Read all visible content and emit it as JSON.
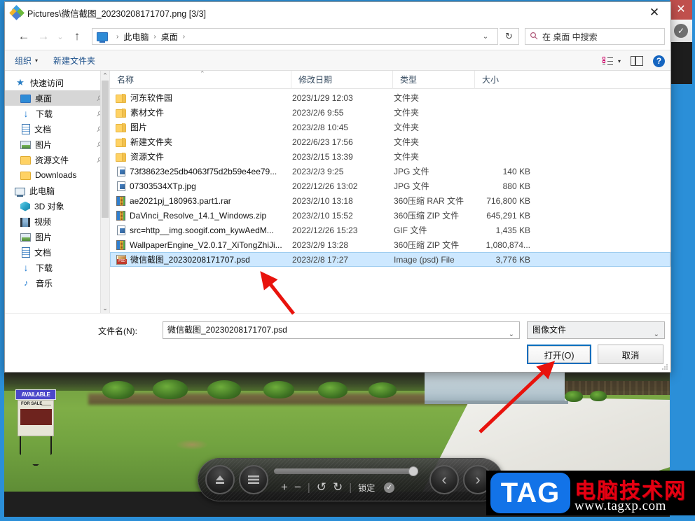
{
  "window": {
    "title": "Pictures\\微信截图_20230208171707.png [3/3]",
    "icon": "photo-viewer-icon",
    "close_label": "✕"
  },
  "nav": {
    "back": "←",
    "forward": "→",
    "recent": "⌄",
    "up": "↑",
    "breadcrumb": [
      "此电脑",
      "桌面"
    ],
    "breadcrumb_sep": "›",
    "refresh": "↻",
    "search_placeholder": "在 桌面 中搜索",
    "search_value": "",
    "search_icon": "search-icon"
  },
  "toolbar": {
    "organize": "组织",
    "organize_caret": "▾",
    "new_folder": "新建文件夹",
    "view_icon": "list-view-icon",
    "view_caret": "▾",
    "preview_pane_icon": "preview-pane-icon",
    "help": "?"
  },
  "sidebar": {
    "items": [
      {
        "label": "快速访问",
        "icon": "star-icon",
        "type": "root",
        "pinned": false,
        "selected": false
      },
      {
        "label": "桌面",
        "icon": "desktop-icon",
        "type": "child",
        "pinned": true,
        "selected": true
      },
      {
        "label": "下载",
        "icon": "download-icon",
        "type": "child",
        "pinned": true,
        "selected": false
      },
      {
        "label": "文档",
        "icon": "document-icon",
        "type": "child",
        "pinned": true,
        "selected": false
      },
      {
        "label": "图片",
        "icon": "picture-icon",
        "type": "child",
        "pinned": true,
        "selected": false
      },
      {
        "label": "资源文件",
        "icon": "folder-icon",
        "type": "child",
        "pinned": true,
        "selected": false
      },
      {
        "label": "Downloads",
        "icon": "folder-icon",
        "type": "child",
        "pinned": false,
        "selected": false
      },
      {
        "label": "此电脑",
        "icon": "pc-icon",
        "type": "root",
        "pinned": false,
        "selected": false
      },
      {
        "label": "3D 对象",
        "icon": "cube-icon",
        "type": "child",
        "pinned": false,
        "selected": false
      },
      {
        "label": "视频",
        "icon": "video-icon",
        "type": "child",
        "pinned": false,
        "selected": false
      },
      {
        "label": "图片",
        "icon": "picture-icon",
        "type": "child",
        "pinned": false,
        "selected": false
      },
      {
        "label": "文档",
        "icon": "document-icon",
        "type": "child",
        "pinned": false,
        "selected": false
      },
      {
        "label": "下载",
        "icon": "download-icon",
        "type": "child",
        "pinned": false,
        "selected": false
      },
      {
        "label": "音乐",
        "icon": "music-icon",
        "type": "child",
        "pinned": false,
        "selected": false
      }
    ],
    "scroll_up": "⌃",
    "scroll_down": "⌄"
  },
  "filelist": {
    "columns": [
      "名称",
      "修改日期",
      "类型",
      "大小"
    ],
    "sort_indicator": "⌃",
    "rows": [
      {
        "name": "河东软件园",
        "icon": "folder-icon",
        "date": "2023/1/29 12:03",
        "type": "文件夹",
        "size": "",
        "selected": false
      },
      {
        "name": "素材文件",
        "icon": "folder-icon",
        "date": "2023/2/6 9:55",
        "type": "文件夹",
        "size": "",
        "selected": false
      },
      {
        "name": "图片",
        "icon": "folder-icon",
        "date": "2023/2/8 10:45",
        "type": "文件夹",
        "size": "",
        "selected": false
      },
      {
        "name": "新建文件夹",
        "icon": "folder-icon",
        "date": "2022/6/23 17:56",
        "type": "文件夹",
        "size": "",
        "selected": false
      },
      {
        "name": "资源文件",
        "icon": "folder-icon",
        "date": "2023/2/15 13:39",
        "type": "文件夹",
        "size": "",
        "selected": false
      },
      {
        "name": "73f38623e25db4063f75d2b59e4ee79...",
        "icon": "jpg-icon",
        "date": "2023/2/3 9:25",
        "type": "JPG 文件",
        "size": "140 KB",
        "selected": false
      },
      {
        "name": "07303534XTp.jpg",
        "icon": "jpg-icon",
        "date": "2022/12/26 13:02",
        "type": "JPG 文件",
        "size": "880 KB",
        "selected": false
      },
      {
        "name": "ae2021pj_180963.part1.rar",
        "icon": "rar-icon",
        "date": "2023/2/10 13:18",
        "type": "360压缩 RAR 文件",
        "size": "716,800 KB",
        "selected": false
      },
      {
        "name": "DaVinci_Resolve_14.1_Windows.zip",
        "icon": "zip-icon",
        "date": "2023/2/10 15:52",
        "type": "360压缩 ZIP 文件",
        "size": "645,291 KB",
        "selected": false
      },
      {
        "name": "src=http__img.soogif.com_kywAedM...",
        "icon": "gif-icon",
        "date": "2022/12/26 15:23",
        "type": "GIF 文件",
        "size": "1,435 KB",
        "selected": false
      },
      {
        "name": "WallpaperEngine_V2.0.17_XiTongZhiJi...",
        "icon": "zip-icon",
        "date": "2023/2/9 13:28",
        "type": "360压缩 ZIP 文件",
        "size": "1,080,874...",
        "selected": false
      },
      {
        "name": "微信截图_20230208171707.psd",
        "icon": "psd-icon",
        "date": "2023/2/8 17:27",
        "type": "Image (psd) File",
        "size": "3,776 KB",
        "selected": true
      }
    ]
  },
  "form": {
    "filename_label": "文件名(N):",
    "filename_value": "微信截图_20230208171707.psd",
    "filetype_value": "图像文件",
    "dropdown_caret": "⌄",
    "open_button": "打开(O)",
    "cancel_button": "取消"
  },
  "background": {
    "close_label": "✕",
    "check_label": "✓",
    "media": {
      "eject_icon": "eject-icon",
      "menu_icon": "menu-icon",
      "zoom_in": "+",
      "zoom_out": "−",
      "rotate_left": "↺",
      "rotate_right": "↻",
      "lock_label": "锁定",
      "lock_check": "✓",
      "prev_icon": "‹",
      "next_icon": "›",
      "separator": "|"
    },
    "sign": {
      "top_text": "AVAILABLE",
      "body_text": "FOR SALE"
    }
  },
  "watermark": {
    "logo": "TAG",
    "site_name": "电脑技术网",
    "url": "www.tagxp.com"
  }
}
